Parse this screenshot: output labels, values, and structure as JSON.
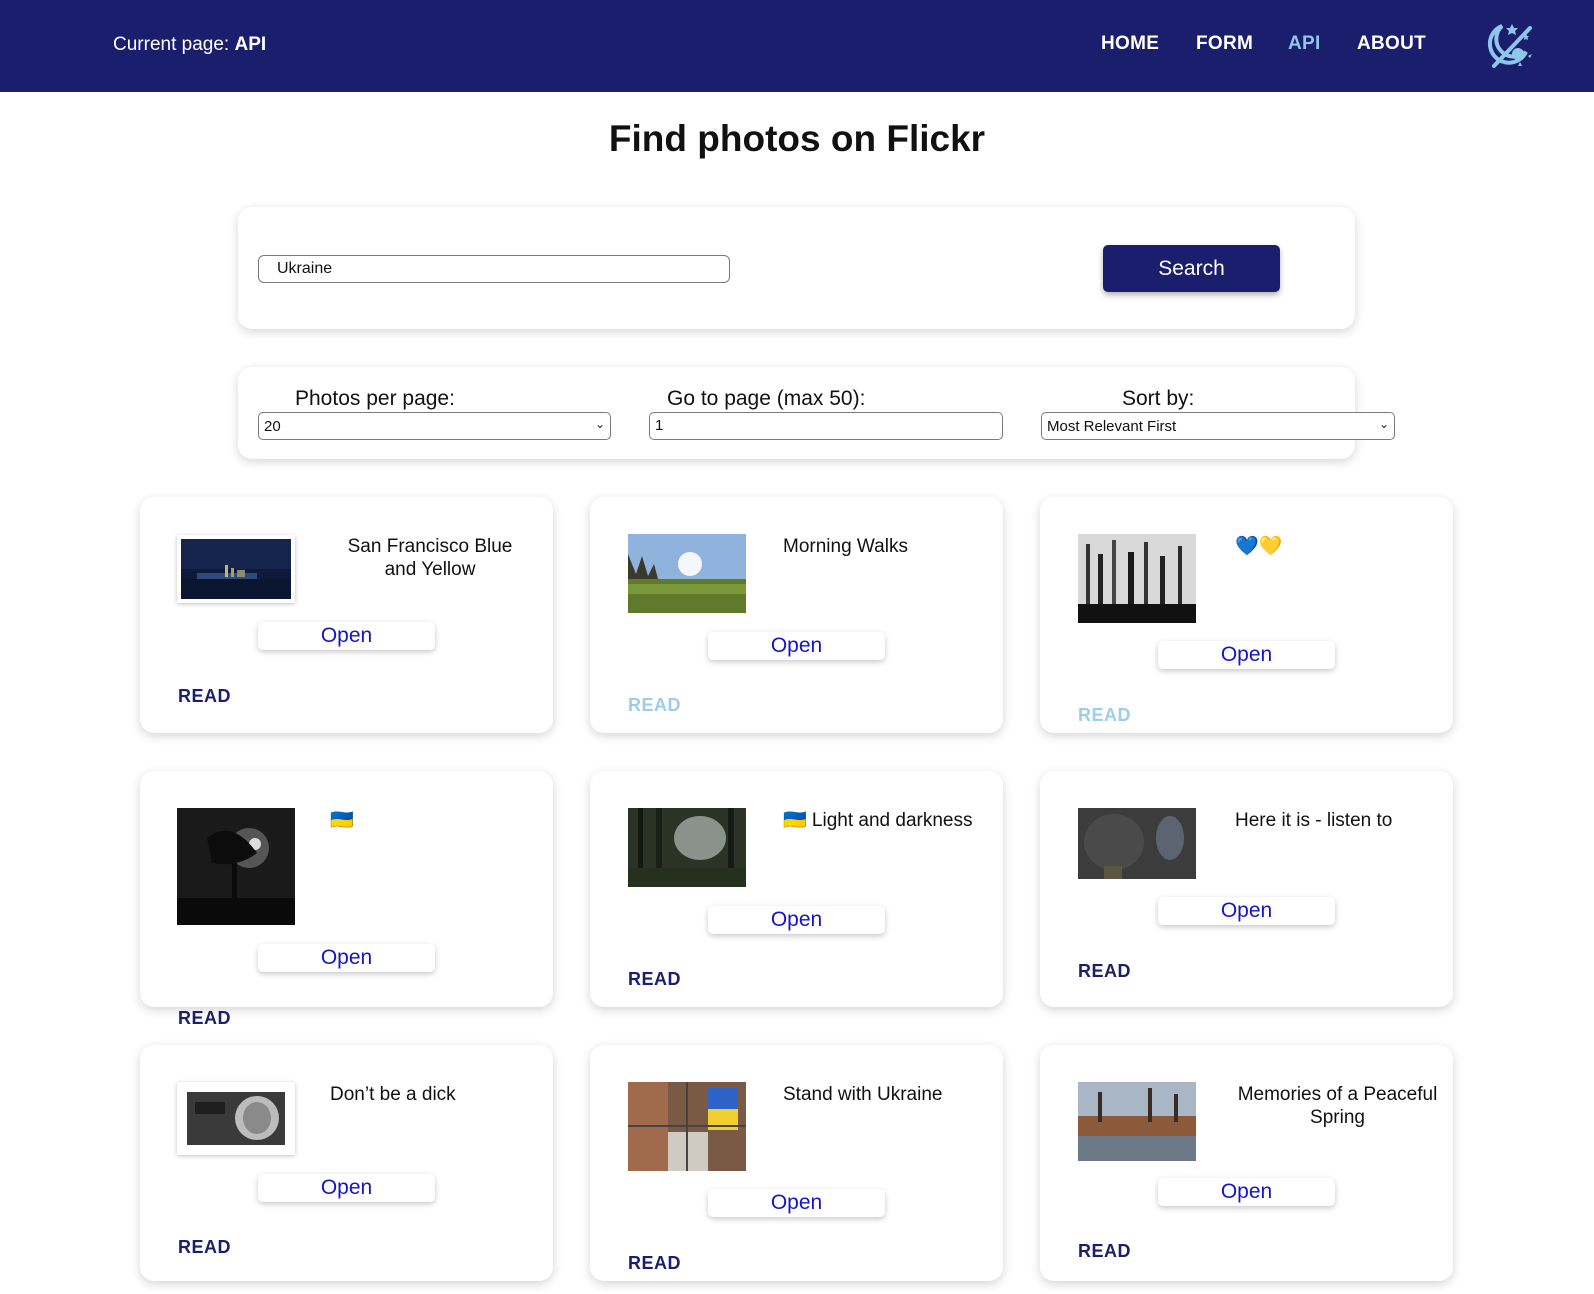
{
  "header": {
    "current_label": "Current page:",
    "current_page": "API",
    "nav": [
      {
        "label": "HOME",
        "active": false
      },
      {
        "label": "FORM",
        "active": false
      },
      {
        "label": "API",
        "active": true
      },
      {
        "label": "ABOUT",
        "active": false
      }
    ],
    "theme_icon": "moon-sun-toggle-icon",
    "colors": {
      "bar": "#1b1e6d",
      "active_link": "#8fc6ec"
    }
  },
  "title": "Find photos on Flickr",
  "search": {
    "value": "Ukraine",
    "button": "Search"
  },
  "controls": {
    "per_page_label": "Photos per page:",
    "per_page_value": "20",
    "goto_label": "Go to page (max 50):",
    "goto_value": "1",
    "sort_label": "Sort by:",
    "sort_value": "Most Relevant First"
  },
  "cards": [
    {
      "title": "San Francisco Blue and Yellow",
      "open": "Open",
      "read": "READ",
      "read_style": "dark"
    },
    {
      "title": "Morning Walks",
      "open": "Open",
      "read": "READ",
      "read_style": "light"
    },
    {
      "title": "💙💛",
      "open": "Open",
      "read": "READ",
      "read_style": "light"
    },
    {
      "title": "🇺🇦",
      "open": "Open",
      "read": "READ",
      "read_style": "dark"
    },
    {
      "title": "🇺🇦 Light and darkness",
      "open": "Open",
      "read": "READ",
      "read_style": "dark"
    },
    {
      "title": "Here it is - listen to",
      "open": "Open",
      "read": "READ",
      "read_style": "dark"
    },
    {
      "title": "Don’t be a dick",
      "open": "Open",
      "read": "READ",
      "read_style": "dark"
    },
    {
      "title": "Stand with Ukraine",
      "open": "Open",
      "read": "READ",
      "read_style": "dark"
    },
    {
      "title": "Memories of a Peaceful Spring",
      "open": "Open",
      "read": "READ",
      "read_style": "dark"
    }
  ]
}
